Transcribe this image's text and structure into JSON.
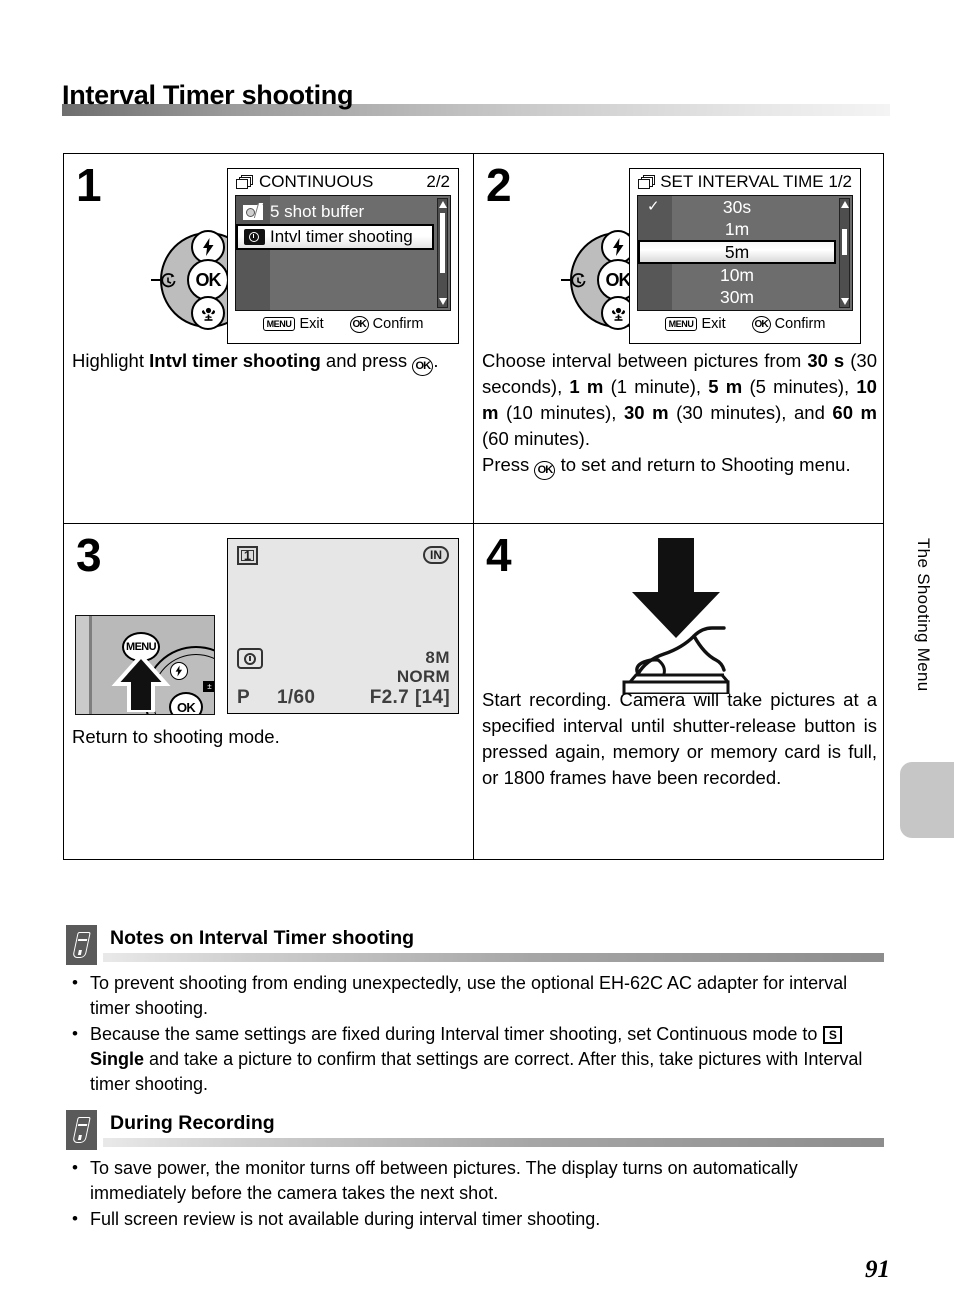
{
  "page": {
    "title": "Interval Timer shooting",
    "number": "91",
    "side_tab": "The Shooting Menu"
  },
  "steps": [
    {
      "number": "1",
      "caption_prefix": "Highlight ",
      "caption_bold": "Intvl timer shooting",
      "caption_suffix": " and press ",
      "caption_end": ".",
      "ok_glyph": "OK",
      "screen": {
        "title": "CONTINUOUS",
        "page_indicator": "2/2",
        "items": [
          {
            "label": "5 shot buffer",
            "icon": "burst-camera-icon",
            "selected": false
          },
          {
            "label": "Intvl timer shooting",
            "icon": "timer-camera-icon",
            "selected": true
          }
        ],
        "footer": [
          {
            "button": "MENU",
            "label": "Exit"
          },
          {
            "button": "OK",
            "label": "Confirm"
          }
        ]
      },
      "dial": {
        "center": "OK",
        "top": "flash-icon",
        "bottom": "macro-icon",
        "left": "self-timer-icon",
        "right": "exposure-compensation-icon"
      }
    },
    {
      "number": "2",
      "caption": "Choose interval between pictures from 30 s (30 seconds), 1 m (1 minute), 5 m (5 minutes), 10 m (10 minutes), 30 m (30 minutes), and 60 m (60 minutes).",
      "caption_line2_prefix": "Press ",
      "caption_line2_suffix": " to set and return to Shooting menu.",
      "ok_glyph": "OK",
      "screen": {
        "title": "SET INTERVAL TIME 1/2",
        "items": [
          {
            "label": "30s",
            "checked": true,
            "selected": false
          },
          {
            "label": "1m",
            "checked": false,
            "selected": false
          },
          {
            "label": "5m",
            "checked": false,
            "selected": true
          },
          {
            "label": "10m",
            "checked": false,
            "selected": false
          },
          {
            "label": "30m",
            "checked": false,
            "selected": false
          }
        ],
        "footer": [
          {
            "button": "MENU",
            "label": "Exit"
          },
          {
            "button": "OK",
            "label": "Confirm"
          }
        ]
      }
    },
    {
      "number": "3",
      "caption": "Return to shooting mode.",
      "camera_back": {
        "menu_button": "MENU",
        "ok_button": "OK",
        "flash_button": "flash-icon",
        "ev_button": "exposure-compensation-icon"
      },
      "screen": {
        "folder_number": "1",
        "memory_indicator": "IN",
        "image_size": "8M",
        "quality": "NORM",
        "mode": "P",
        "shutter_speed": "1/60",
        "aperture": "F2.7",
        "frames_remaining": "14",
        "timer_icon": "interval-timer-icon"
      }
    },
    {
      "number": "4",
      "caption": "Start recording. Camera will take pictures at a specified interval until shutter-release button is pressed again, memory or memory card is full, or 1800 frames have been recorded.",
      "illustration": "press-shutter-button-icon"
    }
  ],
  "notes": [
    {
      "title": "Notes on Interval Timer shooting",
      "items": [
        {
          "parts": [
            {
              "t": "To prevent shooting from ending unexpectedly, use the optional EH-62C AC adapter for interval timer shooting.",
              "b": false
            }
          ]
        },
        {
          "parts": [
            {
              "t": "Because the same settings are fixed during Interval timer shooting, set Continuous mode to ",
              "b": false
            },
            {
              "t": "SINGLE_ICON",
              "icon": "single-mode-icon"
            },
            {
              "t": "Single",
              "b": true
            },
            {
              "t": " and take a picture to confirm that settings are correct. After this, take pictures with Interval timer shooting.",
              "b": false
            }
          ]
        }
      ]
    },
    {
      "title": "During Recording",
      "items": [
        {
          "parts": [
            {
              "t": "To save power, the monitor turns off between pictures. The display turns on automatically immediately before the camera takes the next shot.",
              "b": false
            }
          ]
        },
        {
          "parts": [
            {
              "t": "Full screen review is not available during interval timer shooting.",
              "b": false
            }
          ]
        }
      ]
    }
  ]
}
